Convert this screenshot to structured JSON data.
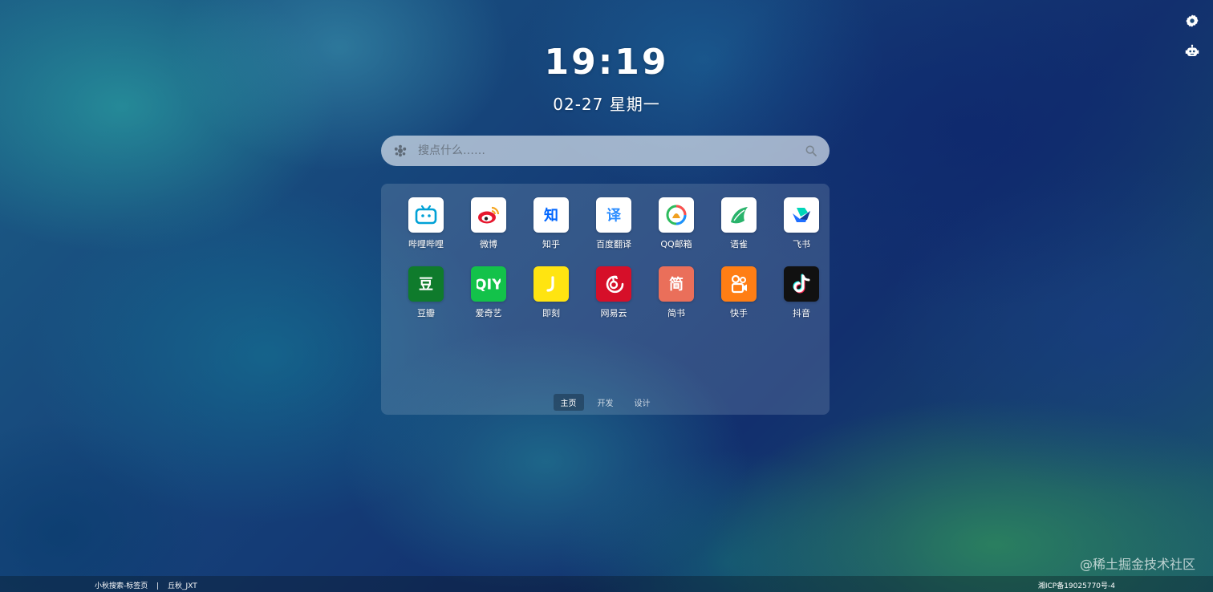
{
  "top_right": {
    "settings_icon": "gear-icon",
    "robot_icon": "robot-icon"
  },
  "clock": {
    "time": "19:19",
    "date": "02-27 星期一"
  },
  "search": {
    "placeholder": "搜点什么……",
    "engine_icon": "engine-icon",
    "submit_icon": "search-icon"
  },
  "apps": [
    {
      "id": "bilibili",
      "label": "哔哩哔哩",
      "bg": "#ffffff",
      "fg": "#00a1d6",
      "glyph": "tv"
    },
    {
      "id": "weibo",
      "label": "微博",
      "bg": "#ffffff",
      "fg": "#e6162d",
      "glyph": "weibo"
    },
    {
      "id": "zhihu",
      "label": "知乎",
      "bg": "#ffffff",
      "fg": "#0066ff",
      "glyph": "知"
    },
    {
      "id": "baidu-translate",
      "label": "百度翻译",
      "bg": "#ffffff",
      "fg": "#2b8cff",
      "glyph": "译"
    },
    {
      "id": "qq-mail",
      "label": "QQ邮箱",
      "bg": "#ffffff",
      "fg": "#f0a020",
      "glyph": "qqmail"
    },
    {
      "id": "yuque",
      "label": "语雀",
      "bg": "#ffffff",
      "fg": "#29b36b",
      "glyph": "yuque"
    },
    {
      "id": "feishu",
      "label": "飞书",
      "bg": "#ffffff",
      "fg": "#1f6fff",
      "glyph": "feishu"
    },
    {
      "id": "douban",
      "label": "豆瓣",
      "bg": "#0f7b2c",
      "fg": "#ffffff",
      "glyph": "豆"
    },
    {
      "id": "iqiyi",
      "label": "爱奇艺",
      "bg": "#13c24a",
      "fg": "#ffffff",
      "glyph": "iQIYI"
    },
    {
      "id": "jike",
      "label": "即刻",
      "bg": "#ffe411",
      "fg": "#ffffff",
      "glyph": "jike"
    },
    {
      "id": "netease-music",
      "label": "网易云",
      "bg": "#d60f29",
      "fg": "#ffffff",
      "glyph": "netease"
    },
    {
      "id": "jianshu",
      "label": "简书",
      "bg": "#ea6f5a",
      "fg": "#ffffff",
      "glyph": "简"
    },
    {
      "id": "kuaishou",
      "label": "快手",
      "bg": "#ff7e14",
      "fg": "#ffffff",
      "glyph": "kuaishou"
    },
    {
      "id": "douyin",
      "label": "抖音",
      "bg": "#111111",
      "fg": "#ffffff",
      "glyph": "douyin"
    }
  ],
  "tabs": [
    {
      "label": "主页",
      "active": true
    },
    {
      "label": "开发",
      "active": false
    },
    {
      "label": "设计",
      "active": false
    }
  ],
  "watermark": "@稀土掘金技术社区",
  "footer": {
    "site_name": "小秋搜索-标签页",
    "separator": "|",
    "author": "丘秋_JXT",
    "icp": "湘ICP备19025770号-4"
  }
}
